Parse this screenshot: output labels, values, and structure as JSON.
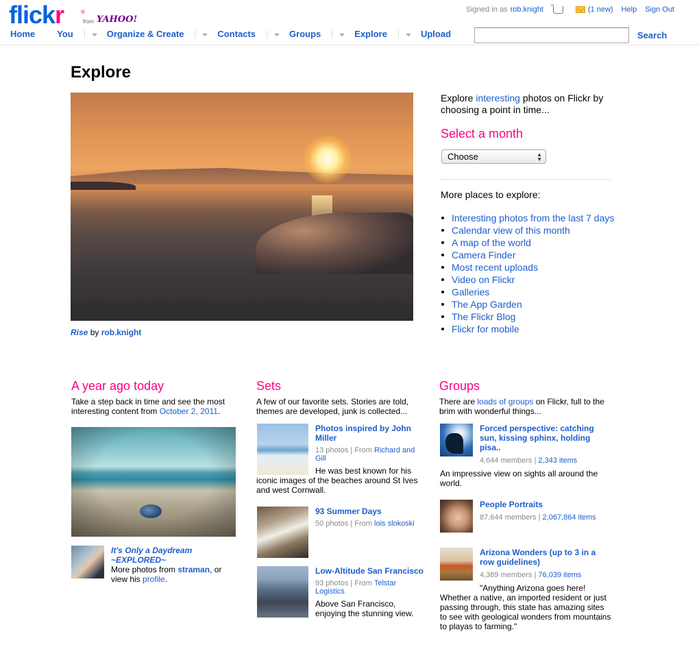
{
  "header": {
    "logo_text_main": "flick",
    "logo_text_r": "r",
    "logo_reg": "®",
    "logo_from": "from",
    "logo_yahoo": "YAHOO!",
    "signed_in_as": "Signed in as",
    "username": "rob.knight",
    "mail_count": "(1 new)",
    "help": "Help",
    "sign_out": "Sign Out",
    "search_button": "Search",
    "search_value": ""
  },
  "nav": {
    "home": "Home",
    "you": "You",
    "organize": "Organize & Create",
    "contacts": "Contacts",
    "groups": "Groups",
    "explore": "Explore",
    "upload": "Upload"
  },
  "main": {
    "title": "Explore",
    "hero_caption_title": "Rise",
    "hero_caption_by": " by ",
    "hero_caption_author": "rob.knight",
    "intro_pre": "Explore ",
    "intro_link": "interesting",
    "intro_post": " photos on Flickr by choosing a point in time...",
    "select_title": "Select a month",
    "select_value": "Choose",
    "more_title": "More places to explore:",
    "more_links": [
      "Interesting photos from the last 7 days",
      "Calendar view of this month",
      "A map of the world",
      "Camera Finder",
      "Most recent uploads",
      "Video on Flickr",
      "Galleries",
      "The App Garden",
      "The Flickr Blog",
      "Flickr for mobile"
    ]
  },
  "year_ago": {
    "title": "A year ago today",
    "desc_pre": "Take a step back in time and see the most interesting content from ",
    "desc_link": "October 2, 2011",
    "desc_post": ".",
    "photo_title": "It's Only a Daydream ~EXPLORED~",
    "more_pre": "More photos from ",
    "more_user": "straman",
    "more_mid": ", or view his ",
    "more_profile": "profile",
    "more_post": "."
  },
  "sets": {
    "title": "Sets",
    "desc": "A few of our favorite sets. Stories are told, themes are developed, junk is collected...",
    "items": [
      {
        "title": "Photos inspired by John Miller",
        "count": "13 photos",
        "from_label": "From",
        "owner": "Richard and Gill",
        "desc": "He was best known for his iconic images of the beaches around St Ives and west Cornwall."
      },
      {
        "title": "93 Summer Days",
        "count": "50 photos",
        "from_label": "From",
        "owner": "lois slokoski",
        "desc": ""
      },
      {
        "title": "Low-Altitude San Francisco",
        "count": "93 photos",
        "from_label": "From",
        "owner": "Telstar Logistics",
        "desc": "Above San Francisco, enjoying the stunning view."
      }
    ]
  },
  "groups": {
    "title": "Groups",
    "desc_pre": "There are ",
    "desc_link": "loads of groups",
    "desc_post": " on Flickr, full to the brim with wonderful things...",
    "items": [
      {
        "title": "Forced perspective: catching sun, kissing sphinx, holding pisa..",
        "members": "4,644 members",
        "items": "2,343 items",
        "desc": "An impressive view on sights all around the world."
      },
      {
        "title": "People Portraits",
        "members": "87,644 members",
        "items": "2,067,864 items",
        "desc": ""
      },
      {
        "title": "Arizona Wonders (up to 3 in a row guidelines)",
        "members": "4,389 members",
        "items": "76,039 items",
        "desc": "\"Anything Arizona goes here! Whether a native, an imported resident or just passing through, this state has amazing sites to see with geological wonders from mountains to playas to farming.\""
      }
    ]
  }
}
